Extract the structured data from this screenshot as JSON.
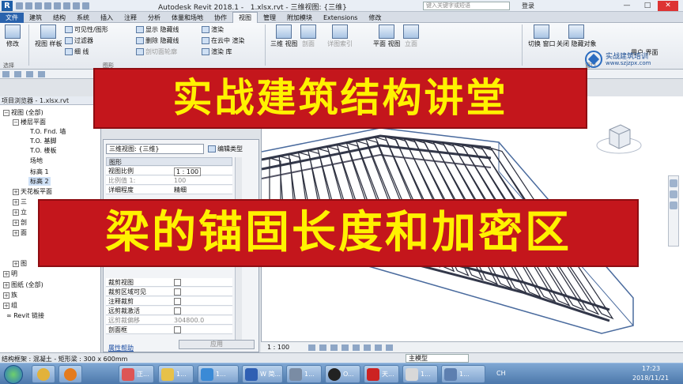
{
  "window": {
    "app_title": "Autodesk Revit 2018.1 -",
    "file_title": "1.xlsx.rvt - 三维视图: {三维}",
    "search_placeholder": "键入关键字或短语",
    "login": "登录"
  },
  "tabs": [
    "文件",
    "建筑",
    "结构",
    "系统",
    "插入",
    "注释",
    "分析",
    "体量和场地",
    "协作",
    "视图",
    "管理",
    "附加模块",
    "Extensions",
    "修改"
  ],
  "ribbon": {
    "modify": "修改",
    "select": "选择",
    "view_template": "视图\n样板",
    "visibility": "可见性/图形",
    "filter": "过滤器",
    "thin_lines": "细 线",
    "show": "显示",
    "hide": "隐藏线",
    "remove": "删除",
    "hidden_lines": "隐藏线",
    "cut_profile": "剖切面轮廓",
    "render": "渲染",
    "in_cloud": "在云中",
    "render2": "渲染",
    "render_gallery": "渲染",
    "library": "库",
    "graphics_label": "图形",
    "threed_view": "三维\n视图",
    "section": "剖面",
    "callout": "详图索引",
    "plan_view": "平面\n视图",
    "elevation": "立面",
    "switch_window": "切换\n窗口",
    "close_hidden": "关闭\n隐藏对象",
    "ui": "用户\n界面",
    "window_label": "窗口"
  },
  "logo": {
    "name": "实战建筑培训",
    "url": "www.szjzpx.com"
  },
  "browser": {
    "title": "项目浏览器 - 1.xlsx.rvt",
    "items": [
      {
        "label": "视图 (全部)",
        "toggle": "−"
      },
      {
        "label": "楼层平面",
        "toggle": "−"
      },
      {
        "label": "T.O. Fnd. 墙"
      },
      {
        "label": "T.O. 基脚"
      },
      {
        "label": "T.O. 楼板"
      },
      {
        "label": "场地"
      },
      {
        "label": "标高 1"
      },
      {
        "label": "标高 2"
      },
      {
        "label": "天花板平面",
        "toggle": "+"
      },
      {
        "label": "三",
        "toggle": "+"
      },
      {
        "label": "立",
        "toggle": "+"
      },
      {
        "label": "剖",
        "toggle": "+"
      },
      {
        "label": "面",
        "toggle": "+"
      },
      {
        "label": "图",
        "toggle": "+"
      },
      {
        "label": "明",
        "toggle": "+"
      },
      {
        "label": "图纸 (全部)",
        "toggle": "+"
      },
      {
        "label": "族",
        "toggle": "+"
      },
      {
        "label": "组",
        "toggle": "+"
      },
      {
        "label": "Revit 链接"
      }
    ]
  },
  "properties": {
    "type_selector": "三维视图: {三维}",
    "edit_type": "编辑类型",
    "group_graphics": "图形",
    "rows": [
      {
        "name": "视图比例",
        "value": "1 : 100",
        "style": "box"
      },
      {
        "name": "比例值 1:",
        "value": "100",
        "style": "grey"
      },
      {
        "name": "详细程度",
        "value": "精细"
      },
      {
        "name": "裁剪视图",
        "value": ""
      },
      {
        "name": "裁剪区域可见",
        "value": ""
      },
      {
        "name": "注释裁剪",
        "value": ""
      },
      {
        "name": "远剪裁激活",
        "value": ""
      },
      {
        "name": "远剪裁偏移",
        "value": "304800.0",
        "style": "grey"
      },
      {
        "name": "剖面框",
        "value": ""
      }
    ],
    "help": "属性帮助",
    "apply": "应用"
  },
  "viewbar": {
    "scale": "1 : 100"
  },
  "status": {
    "text": "结构框架 : 混凝土 - 矩形梁 : 300 x 600mm",
    "model": "主模型"
  },
  "taskbar": {
    "tasks": [
      "正...",
      "1...",
      "1...",
      "W 简...",
      "1...",
      "O...",
      "天...",
      "1...",
      "1..."
    ],
    "lang": "CH",
    "time": "17:23",
    "date": "2018/11/21"
  },
  "banners": {
    "top": "实战建筑结构讲堂",
    "bottom": "梁的锚固长度和加密区"
  }
}
